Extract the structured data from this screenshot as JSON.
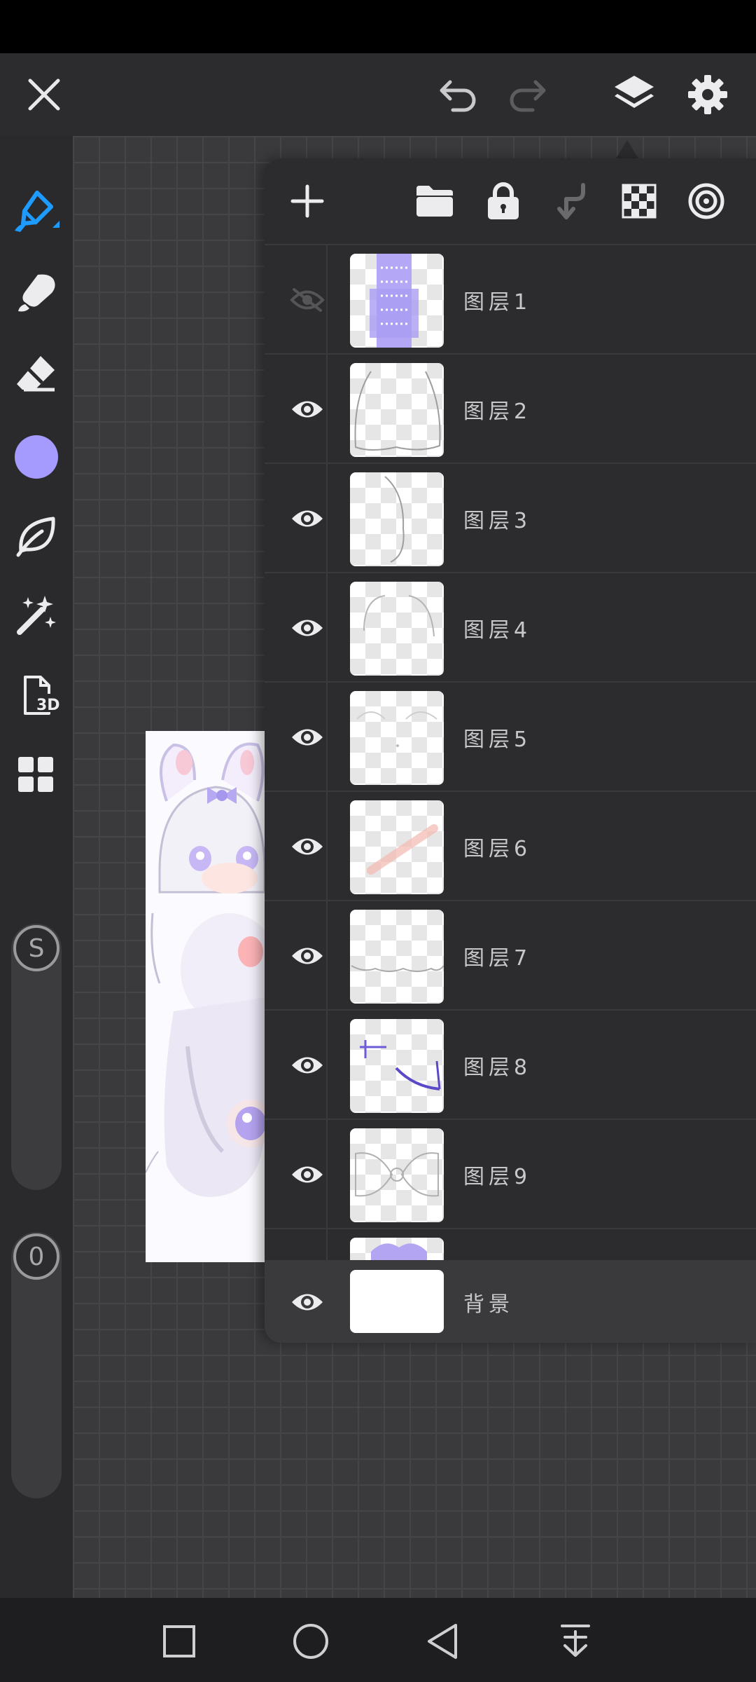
{
  "toolbar": {
    "close_icon": "close-icon",
    "undo_icon": "undo-icon",
    "redo_icon": "redo-icon",
    "layers_icon": "layers-icon",
    "settings_icon": "gear-icon"
  },
  "left_tools": [
    {
      "name": "brush",
      "icon": "brush-icon",
      "active": true
    },
    {
      "name": "smudge",
      "icon": "smudge-icon"
    },
    {
      "name": "eraser",
      "icon": "eraser-icon"
    },
    {
      "name": "color",
      "icon": "color-swatch",
      "color": "#a59bff"
    },
    {
      "name": "leaf",
      "icon": "leaf-icon"
    },
    {
      "name": "magic",
      "icon": "magic-wand-icon"
    },
    {
      "name": "3d",
      "icon": "3d-icon",
      "label": "3D"
    },
    {
      "name": "gallery",
      "icon": "grid-icon"
    }
  ],
  "sliders": {
    "size_label": "S",
    "opacity_label": "0"
  },
  "layer_panel": {
    "toolbar_icons": [
      "add-icon",
      "folder-icon",
      "lock-icon",
      "merge-down-icon",
      "alpha-lock-icon",
      "blend-mode-icon"
    ],
    "layers": [
      {
        "name": "图层1",
        "visible": false
      },
      {
        "name": "图层2",
        "visible": true
      },
      {
        "name": "图层3",
        "visible": true
      },
      {
        "name": "图层4",
        "visible": true
      },
      {
        "name": "图层5",
        "visible": true
      },
      {
        "name": "图层6",
        "visible": true
      },
      {
        "name": "图层7",
        "visible": true
      },
      {
        "name": "图层8",
        "visible": true
      },
      {
        "name": "图层9",
        "visible": true
      }
    ],
    "background_layer": {
      "name": "背景",
      "visible": true
    }
  },
  "colors": {
    "accent": "#1e9bff",
    "brush_color": "#a59bff",
    "panel_bg": "#2c2c2e"
  }
}
